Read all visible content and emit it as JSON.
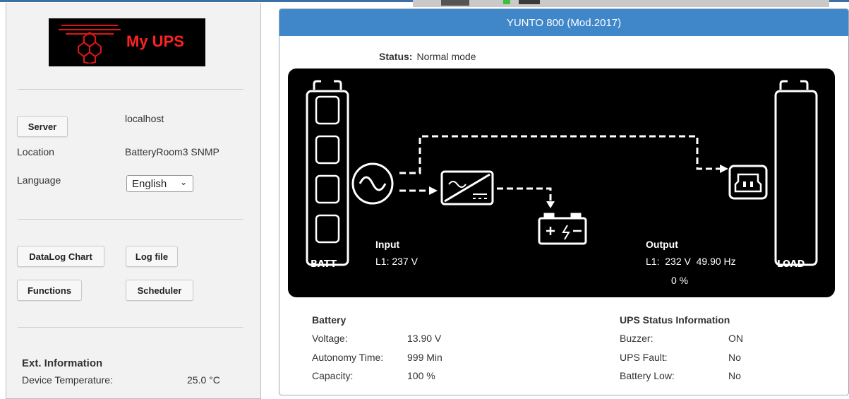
{
  "brand": {
    "name": "My UPS"
  },
  "left": {
    "server_button": "Server",
    "server_value": "localhost",
    "location_label": "Location",
    "location_value": "BatteryRoom3 SNMP",
    "language_label": "Language",
    "language_value": "English",
    "datalog_button": "DataLog Chart",
    "logfile_button": "Log file",
    "functions_button": "Functions",
    "scheduler_button": "Scheduler",
    "ext_title": "Ext. Information",
    "device_temp_label": "Device Temperature:",
    "device_temp_value": "25.0 °C"
  },
  "panel": {
    "title": "YUNTO 800 (Mod.2017)",
    "status_label": "Status:",
    "status_value": "Normal mode"
  },
  "diagram": {
    "batt_label": "BATT",
    "load_label": "LOAD",
    "input_title": "Input",
    "input_l1": "L1:  237 V",
    "output_title": "Output",
    "output_l1": "L1:  232 V  49.90 Hz",
    "output_load": "0 %"
  },
  "battery": {
    "title": "Battery",
    "voltage_label": "Voltage:",
    "voltage_value": "13.90 V",
    "autonomy_label": "Autonomy Time:",
    "autonomy_value": "999 Min",
    "capacity_label": "Capacity:",
    "capacity_value": "100 %"
  },
  "ups_status": {
    "title": "UPS Status Information",
    "buzzer_label": "Buzzer:",
    "buzzer_value": "ON",
    "fault_label": "UPS Fault:",
    "fault_value": "No",
    "batt_low_label": "Battery Low:",
    "batt_low_value": "No"
  },
  "colors": {
    "header_blue": "#3f87c9",
    "logo_red": "#ff2222",
    "diagram_bg": "#000000"
  }
}
